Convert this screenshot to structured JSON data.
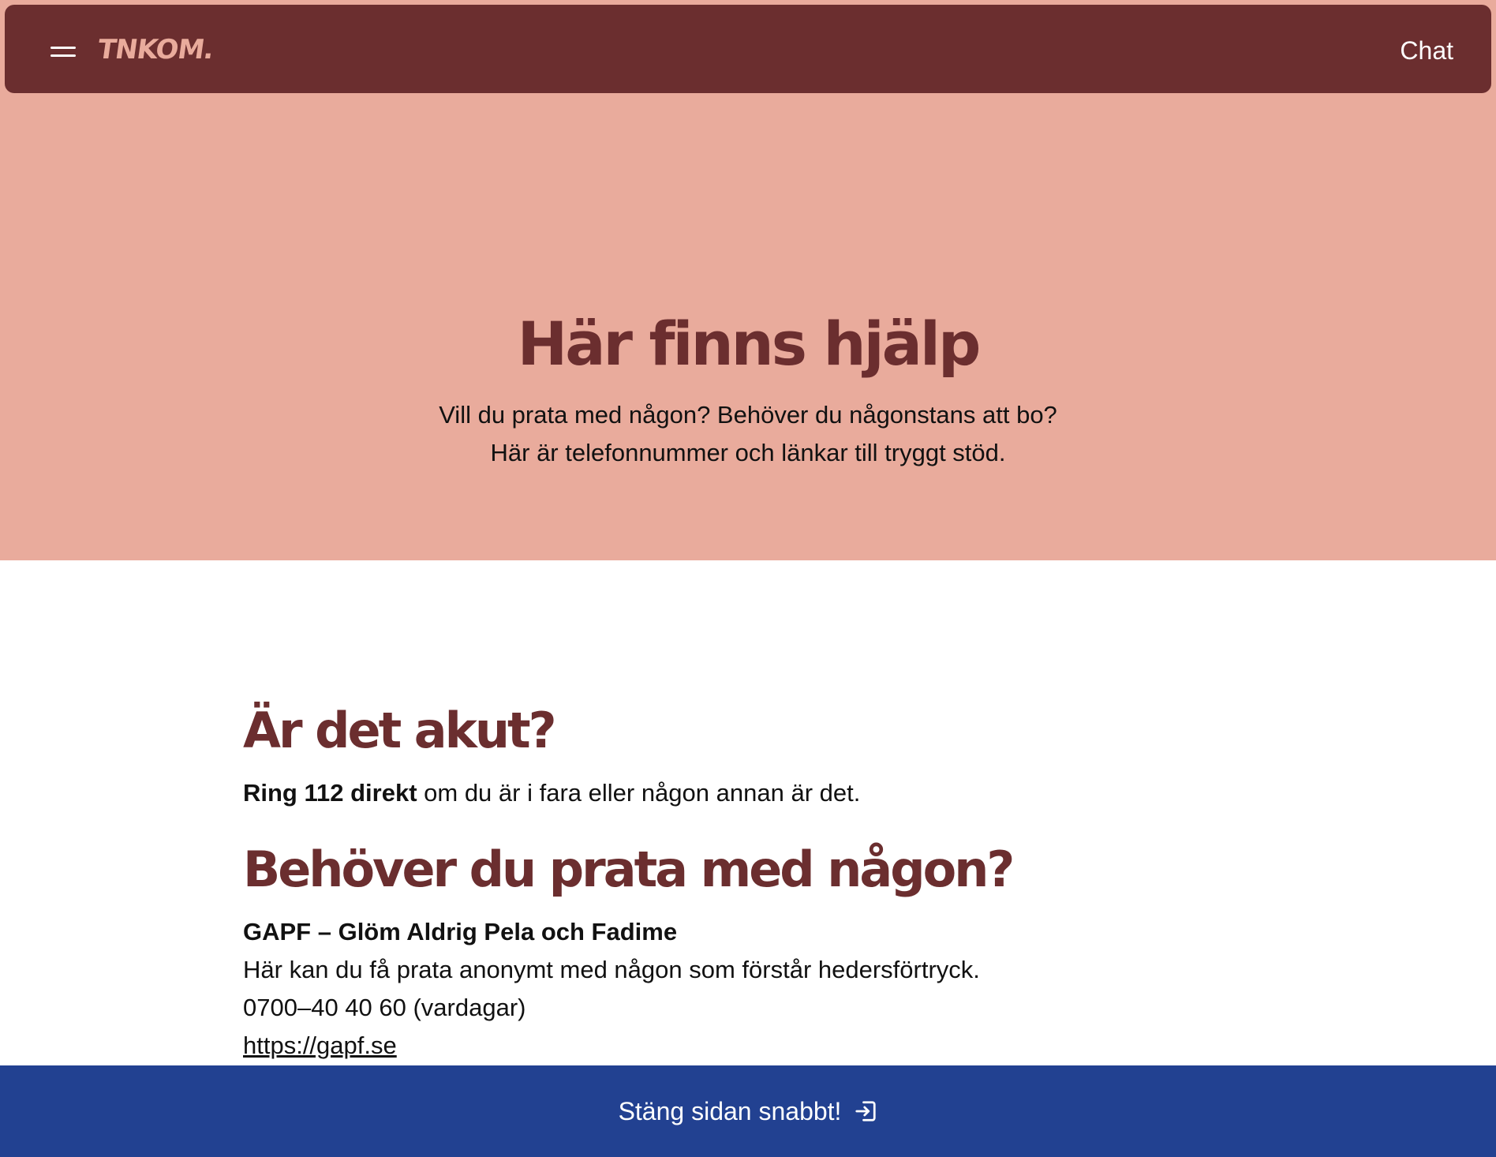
{
  "header": {
    "logo_text": "TNKOM.",
    "chat_label": "Chat"
  },
  "hero": {
    "title": "Här finns hjälp",
    "subtitle_line1": "Vill du prata med någon? Behöver du någonstans att bo?",
    "subtitle_line2": "Här är telefonnummer och länkar till tryggt stöd."
  },
  "sections": {
    "urgent": {
      "heading": "Är det akut?",
      "bold_text": "Ring 112 direkt",
      "rest_text": " om du är i fara eller någon annan är det."
    },
    "talk": {
      "heading": "Behöver du prata med någon?",
      "org_name": "GAPF – Glöm Aldrig Pela och Fadime",
      "description": "Här kan du få prata anonymt med någon som förstår hedersförtryck.",
      "phone": "0700–40 40 60 (vardagar)",
      "link": "https://gapf.se"
    }
  },
  "footer": {
    "exit_label": "Stäng sidan snabbt!",
    "exit_icon": "exit-icon"
  },
  "colors": {
    "brand_dark": "#6b2e2f",
    "brand_light": "#e9ab9c",
    "footer_blue": "#224191"
  }
}
